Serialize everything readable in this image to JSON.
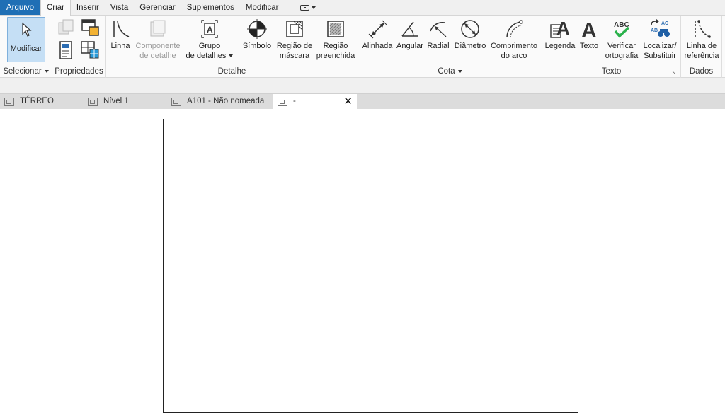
{
  "menu": {
    "tabs": [
      "Arquivo",
      "Criar",
      "Inserir",
      "Vista",
      "Gerenciar",
      "Suplementos",
      "Modificar"
    ],
    "active": "Criar"
  },
  "ribbon": {
    "select_panel": {
      "label": "Selecionar",
      "modify": "Modificar"
    },
    "properties_panel": {
      "label": "Propriedades"
    },
    "detail_panel": {
      "label": "Detalhe",
      "line": "Linha",
      "component_line1": "Componente",
      "component_line2": "de detalhe",
      "group_line1": "Grupo",
      "group_line2": "de detalhes",
      "symbol": "Símbolo",
      "mask_line1": "Região de",
      "mask_line2": "máscara",
      "filled_line1": "Região",
      "filled_line2": "preenchida"
    },
    "dimension_panel": {
      "label": "Cota",
      "aligned": "Alinhada",
      "angular": "Angular",
      "radial": "Radial",
      "diameter": "Diâmetro",
      "arc_line1": "Comprimento",
      "arc_line2": "do arco"
    },
    "text_panel": {
      "label": "Texto",
      "legend": "Legenda",
      "text": "Texto",
      "spell_line1": "Verificar",
      "spell_line2": "ortografia",
      "find_line1": "Localizar/",
      "find_line2": "Substituir",
      "abc": "ABC",
      "ac": "AC",
      "ab": "AB"
    },
    "data_panel": {
      "label": "Dados",
      "ref_line1": "Linha de",
      "ref_line2": "referência"
    }
  },
  "view_tabs": [
    {
      "label": "TÉRREO"
    },
    {
      "label": "Nível 1"
    },
    {
      "label": "A101 - Não nomeada"
    },
    {
      "label": "-"
    }
  ],
  "close_glyph": "✕",
  "colors": {
    "file_tab": "#1f6fb5",
    "selected_button": "#c5dff5",
    "accent_green": "#2bb24c"
  }
}
